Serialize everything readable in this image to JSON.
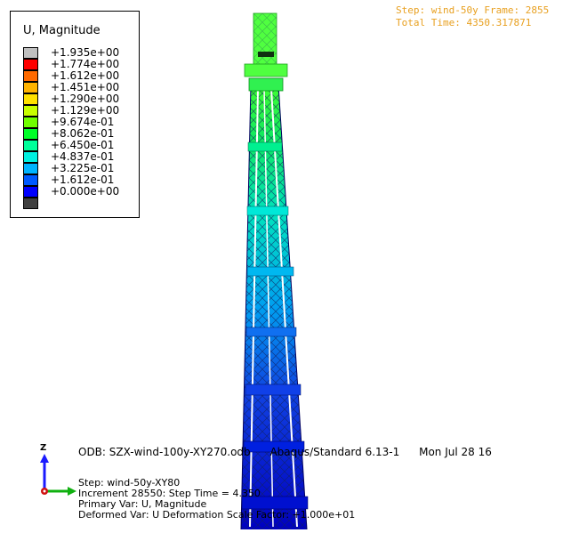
{
  "legend": {
    "title": "U, Magnitude",
    "entries": [
      {
        "label": "+1.935e+00",
        "color": "#c0c0c0"
      },
      {
        "label": "+1.774e+00",
        "color": "#ff0000"
      },
      {
        "label": "+1.612e+00",
        "color": "#ff6a00"
      },
      {
        "label": "+1.451e+00",
        "color": "#ffb300"
      },
      {
        "label": "+1.290e+00",
        "color": "#ffe100"
      },
      {
        "label": "+1.129e+00",
        "color": "#c8ff00"
      },
      {
        "label": "+9.674e-01",
        "color": "#70ff00"
      },
      {
        "label": "+8.062e-01",
        "color": "#00ff28"
      },
      {
        "label": "+6.450e-01",
        "color": "#00ff9a"
      },
      {
        "label": "+4.837e-01",
        "color": "#00f0e0"
      },
      {
        "label": "+3.225e-01",
        "color": "#00b4ff"
      },
      {
        "label": "+1.612e-01",
        "color": "#005aff"
      },
      {
        "label": "+0.000e+00",
        "color": "#0000ff"
      },
      {
        "label": "",
        "color": "#404040"
      }
    ]
  },
  "step_info": {
    "step_line": "Step: wind-50y Frame: 2855",
    "time_line": "Total Time: 4350.317871"
  },
  "footer": {
    "odb": "ODB: SZX-wind-100y-XY270.odb",
    "solver": "Abaqus/Standard 6.13-1",
    "date": "Mon Jul 28 16",
    "step": "Step: wind-50y-XY80",
    "increment": "Increment  28550: Step Time =  4.350",
    "primary_var": "Primary Var: U, Magnitude",
    "deformed_var": "Deformed Var: U   Deformation Scale Factor: +1.000e+01"
  },
  "triad": {
    "axis_label": "Z"
  },
  "colors": {
    "tower_top": "#40ff30",
    "tower_mid": "#00e0c0",
    "tower_low": "#1040e0",
    "tower_base": "#0000c0"
  }
}
